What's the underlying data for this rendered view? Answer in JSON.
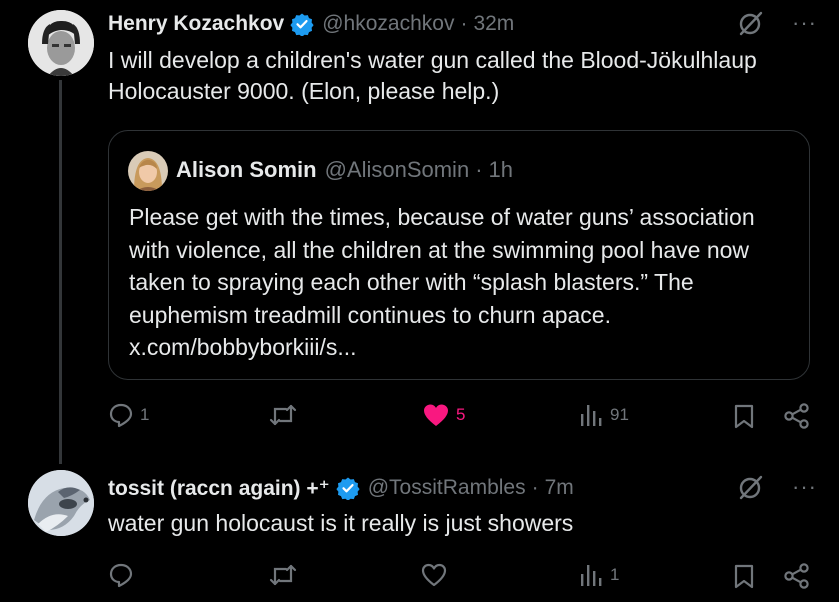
{
  "tweet1": {
    "name": "Henry Kozachkov",
    "handle": "@hkozachkov",
    "sep": "·",
    "time": "32m",
    "more": "···",
    "text": "I will develop a children's water gun called the Blood-Jökulhlaup Holocauster 9000. (Elon, please help.)",
    "quote": {
      "name": "Alison Somin",
      "handle": "@AlisonSomin",
      "sep": "·",
      "time": "1h",
      "text": "Please get with the times, because of water guns’ association with violence, all the children at the swimming pool have now taken to spraying each other with “splash blasters.” The euphemism treadmill continues to churn apace. x.com/bobbyborkiii/s..."
    },
    "actions": {
      "replies": "1",
      "reposts": "",
      "likes": "5",
      "views": "91"
    }
  },
  "tweet2": {
    "name": "tossit (raccn again) +⁺",
    "handle": "@TossitRambles",
    "sep": "·",
    "time": "7m",
    "more": "···",
    "text": "water gun holocaust is it really is just showers",
    "actions": {
      "replies": "",
      "reposts": "",
      "likes": "",
      "views": "1"
    }
  },
  "colors": {
    "background": "#000000",
    "text": "#e7e9ea",
    "secondary": "#71767b",
    "verified": "#1d9bf0",
    "like": "#f91880",
    "border": "#2f3336"
  }
}
